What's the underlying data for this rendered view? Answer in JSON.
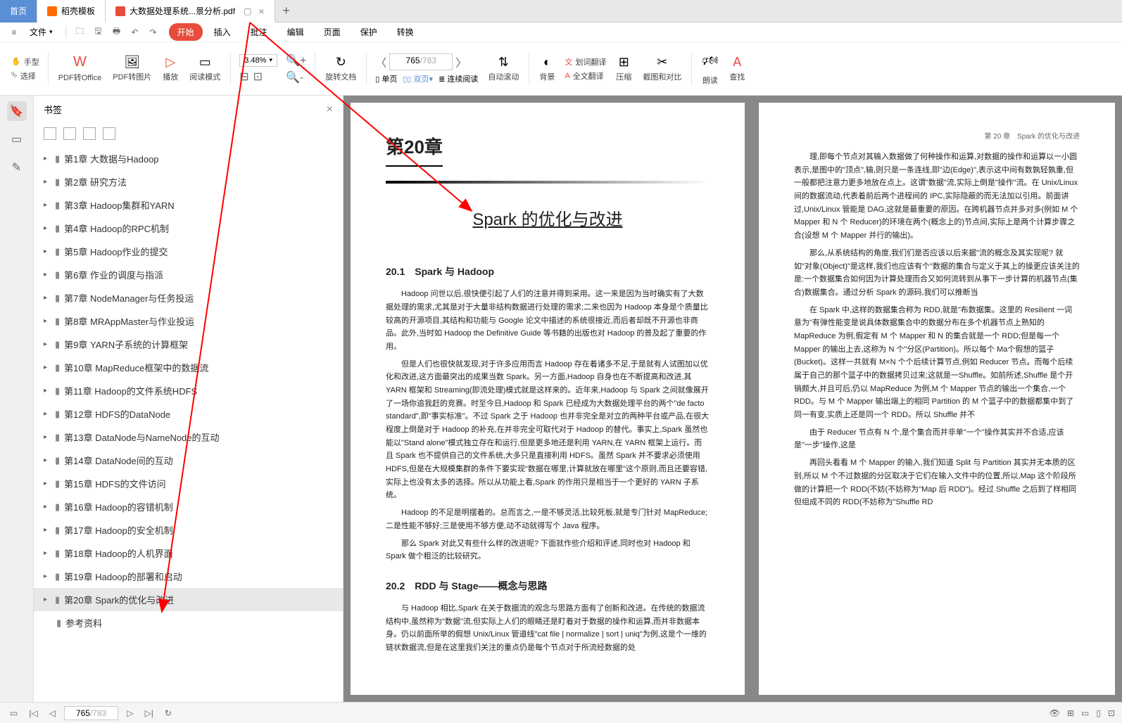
{
  "tabs": {
    "home": "首页",
    "template": "稻壳模板",
    "doc": "大数据处理系统...景分析.pdf"
  },
  "menu": {
    "file": "文件",
    "items": [
      "开始",
      "插入",
      "批注",
      "编辑",
      "页面",
      "保护",
      "转换"
    ]
  },
  "toolbar": {
    "hand": "手型",
    "select": "选择",
    "pdf_office": "PDF转Office",
    "pdf_img": "PDF转图片",
    "play": "播放",
    "read_mode": "阅读模式",
    "zoom": "3.48%",
    "rotate": "旋转文档",
    "single_page": "单页",
    "double_page": "双页",
    "continuous": "连续阅读",
    "auto_scroll": "自动滚动",
    "background": "背景",
    "word_translate": "划词翻译",
    "full_translate": "全文翻译",
    "compress": "压缩",
    "screenshot": "截图和对比",
    "read_aloud": "朗读",
    "find": "查找",
    "page_current": "765",
    "page_total": "/783"
  },
  "bookmarks": {
    "title": "书签",
    "items": [
      "第1章 大数据与Hadoop",
      "第2章 研究方法",
      "第3章 Hadoop集群和YARN",
      "第4章 Hadoop的RPC机制",
      "第5章 Hadoop作业的提交",
      "第6章 作业的调度与指派",
      "第7章 NodeManager与任务投运",
      "第8章 MRAppMaster与作业投运",
      "第9章 YARN子系统的计算框架",
      "第10章 MapReduce框架中的数据流",
      "第11章 Hadoop的文件系统HDFS",
      "第12章 HDFS的DataNode",
      "第13章 DataNode与NameNode的互动",
      "第14章 DataNode间的互动",
      "第15章 HDFS的文件访问",
      "第16章 Hadoop的容错机制",
      "第17章 Hadoop的安全机制",
      "第18章 Hadoop的人机界面",
      "第19章 Hadoop的部署和启动",
      "第20章 Spark的优化与改进"
    ],
    "appendix": "参考资料"
  },
  "document": {
    "chapter_num": "第20章",
    "chapter_title": "Spark 的优化与改进",
    "section1": "20.1　Spark 与 Hadoop",
    "section2": "20.2　RDD 与 Stage——概念与思路",
    "page2_header": "第 20 章　Spark 的优化与改进",
    "p1_1": "Hadoop 问世以后,很快便引起了人们的注意并得到采用。这一来是因为当时确实有了大数据处理的需求,尤其是对于大量非结构数据进行处理的需求;二来也因为 Hadoop 本身是个质量比较高的开源项目,其结构和功能与 Google 论文中描述的系统很接近,而后者却既不开源也非商品。此外,当时如 Hadoop the Definitive Guide 等书籍的出版也对 Hadoop 的普及起了重要的作用。",
    "p1_2": "但是人们也很快就发现,对于许多应用而言 Hadoop 存在着诸多不足,于是就有人试图加以优化和改进,这方面最突出的成果当数 Spark。另一方面,Hadoop 自身也在不断提高和改进,其 YARN 框架和 Streaming(即流处理)模式就是这样来的。近年来,Hadoop 与 Spark 之间就像展开了一场你追我赶的竞赛。时至今日,Hadoop 和 Spark 已经成为大数据处理平台的两个\"de facto standard\",即\"事实标准\"。不过 Spark 之于 Hadoop 也并非完全是对立的两种平台或产品,在很大程度上倒是对于 Hadoop 的补充,在并非完全可取代对于 Hadoop 的替代。事实上,Spark 虽然也能以\"Stand alone\"模式独立存在和运行,但是更多地还是利用 YARN,在 YARN 框架上运行。而且 Spark 也不提供自己的文件系统,大多只是直接利用 HDFS。虽然 Spark 并不要求必须使用 HDFS,但是在大规模集群的条件下要实现\"数据在哪里,计算就放在哪里\"这个原则,而且还要容错,实际上也没有太多的选择。所以从功能上看,Spark 的作用只是相当于一个更好的 YARN 子系统。",
    "p1_3": "Hadoop 的不足是明摆着的。总而言之,一是不够灵活,比较死板,就是专门针对 MapReduce;二是性能不够好;三是使用不够方便,动不动就得写个 Java 程序。",
    "p1_4": "那么 Spark 对此又有些什么样的改进呢? 下面就作些介绍和评述,同时也对 Hadoop 和 Spark 做个粗泛的比较研究。",
    "p1_5": "与 Hadoop 相比,Spark 在关于数据流的观念与思路方面有了创新和改进。在传统的数据流结构中,虽然称为\"数据\"流,但实际上人们的眼睛还是盯着对于数据的操作和运算,而并非数据本身。仍以前面所举的假想 Unix/Linux 管道线\"cat file | normalize | sort | uniq\"为例,这是个一维的链状数据流,但是在这里我们关注的重点仍是每个节点对于所流经数据的处",
    "p2_1": "理,即每个节点对其输入数据做了何种操作和运算,对数据的操作和运算以一小圆表示,是图中的\"顶点\",输,则只是一条连线,即\"边(Edge)\",表示这中间有数孰轻孰重,但一般都把注意力更多地放在点上。这谓\"数据\"流,实际上倒是\"操作\"流。在 Unix/Linux 间的数据流动,代表着前后两个进程间的 IPC,实际隐蔽的而无法加以引用。前面讲过,Unix/Linux 管能是 DAG,这就是最重要的原因。在跨机器节点并多对多(例如 M 个 Mapper 和 N 个 Reducer)的环境在两个(概念上的)节点间,实际上是两个计算步骤之合(设想 M 个 Mapper 并行的输出)。",
    "p2_2": "那么,从系统结构的角度,我们们是否应该以后来据\"流的概念及其实现呢? 就如\"对象(Object)\"是这样,我们也应该有个\"数据的集合与定义于其上的操更应该关注的是:一个数据集合如何因为计算处理而合又如何流转到从事下一步计算的机器节点(集合)数据集合。通过分析 Spark 的源码,我们可以推断当",
    "p2_3": "在 Spark 中,这样的数据集合称为 RDD,就是\"布数据集。这里的 Resilient 一词意为\"有弹性能变是说具体数据集合中的数据分布在多个机器节点上熟知的 MapReduce 为例,假定有 M 个 Mapper 和 N 的集合就是一个 RDD;但是每一个 Mapper 的输出上去,这称为 N 个\"分区(Partition)。所以每个 Ma个假想的篮子(Bucket)。这样一共就有 M×N 个个后续计算节点,例如 Reducer 节点。而每个后续属于自己的那个篮子中的数据拷贝过来;这就是一Shuffle。如前所述,Shuffle 是个开销颇大,并且可后,仍以 MapReduce 为例,M 个 Mapper 节点的输出一个集合,一个 RDD。与 M 个 Mapper 输出端上的相同 Partition 的 M 个篮子中的数据都集中到了同一有变,实质上还是同一个 RDD。所以 Shuffle 并不",
    "p2_4": "由于 Reducer 节点有 N 个,是个集合而并非单\"一个\"操作其实并不合适,应该是\"一步\"操作,这是",
    "p2_5": "再回头看看 M 个 Mapper 的输入,我们知道 Split 与 Partition 其实并无本质的区别,所以 M 个不过数据的分区取决于它们在输入文件中的位置,所以,Map 这个阶段所做的计算把一个 RDD(不妨(不妨称为\"Map 后 RDD\")。经过 Shuffle 之后到了样相同但组成不同的 RDD(不妨称为\"Shuffle RD"
  },
  "status": {
    "page_current": "765",
    "page_total": "/783"
  }
}
